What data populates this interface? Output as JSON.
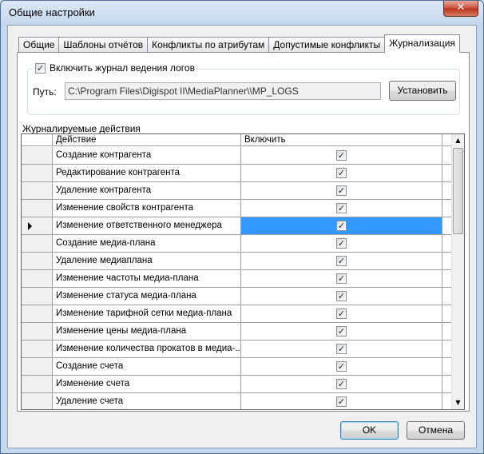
{
  "window": {
    "title": "Общие настройки",
    "close_glyph": "✕"
  },
  "tabs": [
    {
      "label": "Общие",
      "active": false
    },
    {
      "label": "Шаблоны отчётов",
      "active": false
    },
    {
      "label": "Конфликты по атрибутам",
      "active": false
    },
    {
      "label": "Допустимые конфликты",
      "active": false
    },
    {
      "label": "Журнализация",
      "active": true
    }
  ],
  "logging": {
    "enable_label": "Включить журнал ведения логов",
    "enabled": true,
    "path_label": "Путь:",
    "path_value": "C:\\Program Files\\Digispot II\\MediaPlanner\\\\MP_LOGS",
    "set_button": "Установить"
  },
  "actions_section": "Журналируемые действия",
  "grid": {
    "columns": [
      "Действие",
      "Включить"
    ],
    "selected_row": 4,
    "rows": [
      {
        "action": "Создание контрагента",
        "enabled": true
      },
      {
        "action": "Редактирование контрагента",
        "enabled": true
      },
      {
        "action": "Удаление контрагента",
        "enabled": true
      },
      {
        "action": "Изменение свойств контрагента",
        "enabled": true
      },
      {
        "action": "Изменение ответственного менеджера",
        "enabled": true
      },
      {
        "action": "Создание медиа-плана",
        "enabled": true
      },
      {
        "action": "Удаление медиаплана",
        "enabled": true
      },
      {
        "action": "Изменение частоты медиа-плана",
        "enabled": true
      },
      {
        "action": "Изменение статуса медиа-плана",
        "enabled": true
      },
      {
        "action": "Изменение тарифной сетки медиа-плана",
        "enabled": true
      },
      {
        "action": "Изменение цены медиа-плана",
        "enabled": true
      },
      {
        "action": "Изменение количества прокатов в медиа-...",
        "enabled": true
      },
      {
        "action": "Создание счета",
        "enabled": true
      },
      {
        "action": "Изменение счета",
        "enabled": true
      },
      {
        "action": "Удаление счета",
        "enabled": true
      }
    ]
  },
  "check_glyph": "✓",
  "scroll": {
    "up_glyph": "▲",
    "down_glyph": "▼"
  },
  "buttons": {
    "ok": "OK",
    "cancel": "Отмена"
  }
}
